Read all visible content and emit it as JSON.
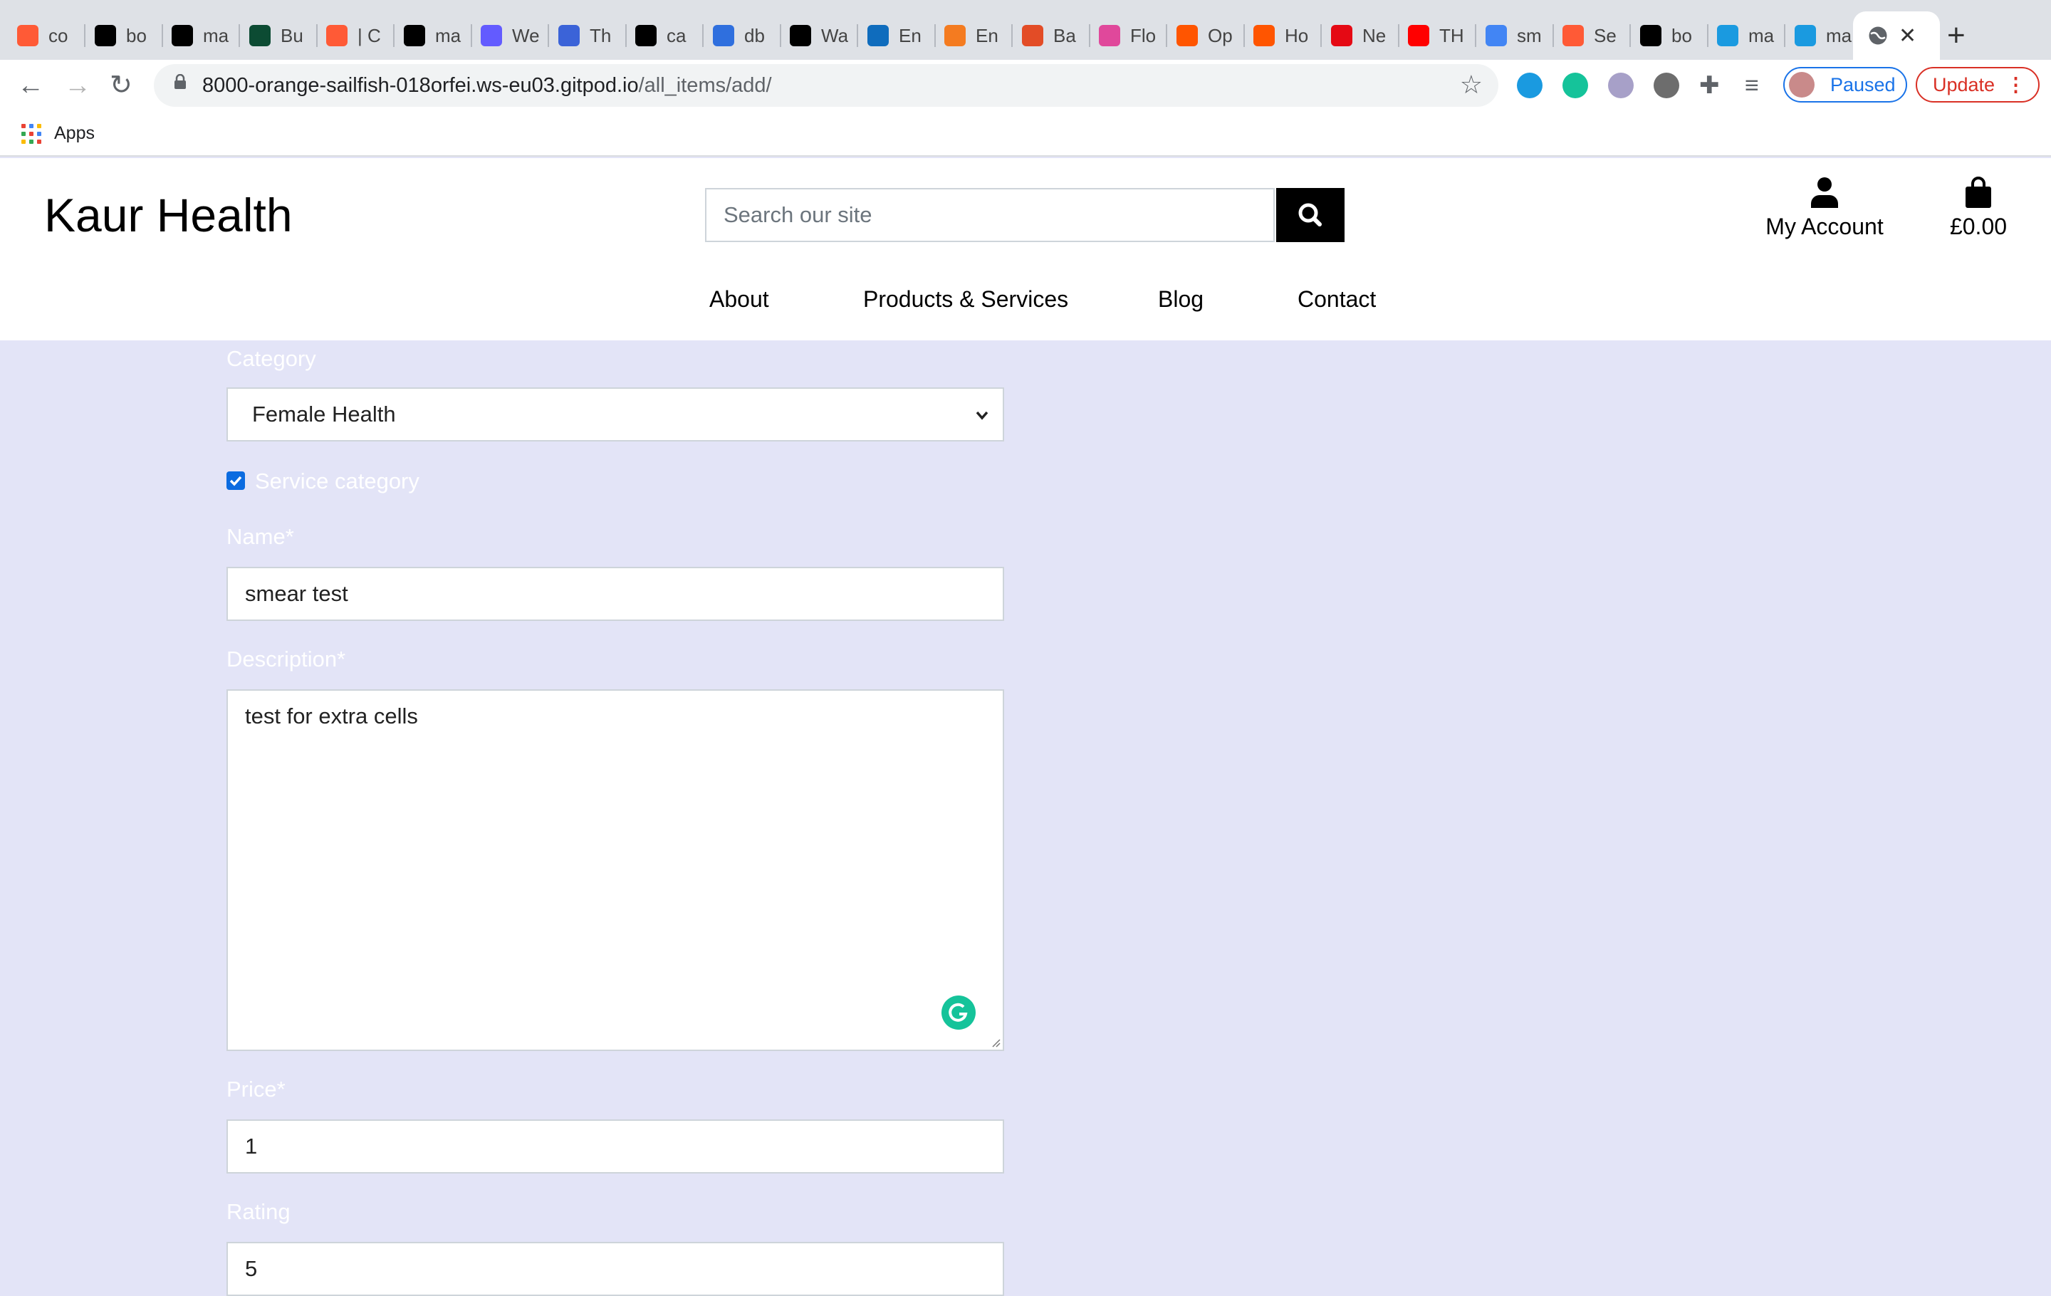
{
  "browser": {
    "tabs": [
      {
        "label": "co",
        "icon": "circle-icon",
        "color": "#ff5a36"
      },
      {
        "label": "bo",
        "icon": "github-icon",
        "color": "#000000"
      },
      {
        "label": "ma",
        "icon": "github-icon",
        "color": "#000000"
      },
      {
        "label": "Bu",
        "icon": "django-icon",
        "color": "#0c4b33"
      },
      {
        "label": "| C",
        "icon": "circle-icon",
        "color": "#ff5a36"
      },
      {
        "label": "ma",
        "icon": "github-icon",
        "color": "#000000"
      },
      {
        "label": "We",
        "icon": "s-icon",
        "color": "#635bff"
      },
      {
        "label": "Th",
        "icon": "c-icon",
        "color": "#3b63d8"
      },
      {
        "label": "ca",
        "icon": "github-icon",
        "color": "#000000"
      },
      {
        "label": "db",
        "icon": "share-icon",
        "color": "#2f6fde"
      },
      {
        "label": "Wa",
        "icon": "amazon-icon",
        "color": "#000000"
      },
      {
        "label": "En",
        "icon": "outlook-icon",
        "color": "#0f6cbd"
      },
      {
        "label": "En",
        "icon": "do-icon",
        "color": "#f47b20"
      },
      {
        "label": "Ba",
        "icon": "diamond-icon",
        "color": "#e34c26"
      },
      {
        "label": "Flo",
        "icon": "flow-icon",
        "color": "#e0489b"
      },
      {
        "label": "Op",
        "icon": "soundcloud-icon",
        "color": "#ff5500"
      },
      {
        "label": "Ho",
        "icon": "soundcloud-icon",
        "color": "#ff5500"
      },
      {
        "label": "Ne",
        "icon": "netflix-icon",
        "color": "#e50914"
      },
      {
        "label": "TH",
        "icon": "youtube-icon",
        "color": "#ff0000"
      },
      {
        "label": "sm",
        "icon": "google-icon",
        "color": "#4285f4"
      },
      {
        "label": "Se",
        "icon": "circle-icon",
        "color": "#ff5a36"
      },
      {
        "label": "bo",
        "icon": "github-icon",
        "color": "#000000"
      },
      {
        "label": "ma",
        "icon": "cube-icon",
        "color": "#1a9ae0"
      },
      {
        "label": "ma",
        "icon": "cube-icon",
        "color": "#1a9ae0"
      }
    ],
    "url_host": "8000-orange-sailfish-018orfei.ws-eu03.gitpod.io",
    "url_path": "/all_items/add/",
    "profile_label": "Paused",
    "update_label": "Update",
    "bookmarks": {
      "apps_label": "Apps"
    }
  },
  "site": {
    "logo": "Kaur Health",
    "search_placeholder": "Search our site",
    "account_label": "My Account",
    "bag_total": "£0.00",
    "nav": [
      "About",
      "Products & Services",
      "Blog",
      "Contact"
    ]
  },
  "form": {
    "category_label": "Category",
    "category_value": "Female Health",
    "service_label": "Service category",
    "service_checked": true,
    "name_label": "Name*",
    "name_value": "smear test",
    "description_label": "Description*",
    "description_value": "test for extra cells",
    "price_label": "Price*",
    "price_value": "1",
    "rating_label": "Rating",
    "rating_value": "5"
  },
  "colors": {
    "page_background": "#e3e4f7",
    "accent_blue": "#1a73e8",
    "update_red": "#d93025",
    "grammarly": "#15c39a"
  }
}
